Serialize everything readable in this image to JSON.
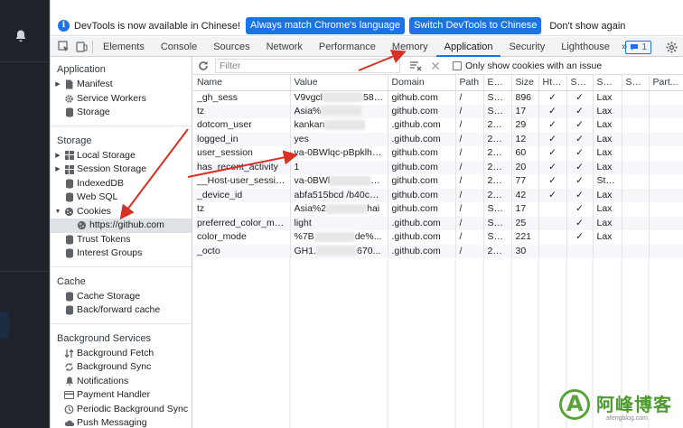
{
  "infobar": {
    "message": "DevTools is now available in Chinese!",
    "match_button": "Always match Chrome's language",
    "switch_button": "Switch DevTools to Chinese",
    "dismiss_button": "Don't show again"
  },
  "tabs": {
    "elements": "Elements",
    "console": "Console",
    "sources": "Sources",
    "network": "Network",
    "performance": "Performance",
    "memory": "Memory",
    "application": "Application",
    "security": "Security",
    "lighthouse": "Lighthouse",
    "more": "»",
    "issues_count": "1"
  },
  "sidebar": {
    "application_title": "Application",
    "manifest": "Manifest",
    "service_workers": "Service Workers",
    "storage": "Storage",
    "storage_title": "Storage",
    "local_storage": "Local Storage",
    "session_storage": "Session Storage",
    "indexeddb": "IndexedDB",
    "web_sql": "Web SQL",
    "cookies": "Cookies",
    "cookies_github": "https://github.com",
    "trust_tokens": "Trust Tokens",
    "interest_groups": "Interest Groups",
    "cache_title": "Cache",
    "cache_storage": "Cache Storage",
    "bf_cache": "Back/forward cache",
    "bg_title": "Background Services",
    "bg_fetch": "Background Fetch",
    "bg_sync": "Background Sync",
    "notifications": "Notifications",
    "payment_handler": "Payment Handler",
    "periodic_bg_sync": "Periodic Background Sync",
    "push_messaging": "Push Messaging"
  },
  "filter": {
    "placeholder": "Filter",
    "issue_label": "Only show cookies with an issue"
  },
  "table": {
    "headers": [
      "Name",
      "Value",
      "Domain",
      "Path",
      "Expi...",
      "Size",
      "Htt...",
      "Sec...",
      "Sam...",
      "Sa...",
      "Part..."
    ],
    "rows": [
      [
        "_gh_sess",
        "V9vgcl",
        "58G...",
        "github.com",
        "/",
        "Ses...",
        "896",
        "✓",
        "✓",
        "Lax",
        "",
        ""
      ],
      [
        "tz",
        "Asia%",
        "",
        "github.com",
        "/",
        "Ses...",
        "17",
        "✓",
        "✓",
        "Lax",
        "",
        ""
      ],
      [
        "dotcom_user",
        "kankan",
        "",
        ".github.com",
        "/",
        "202...",
        "29",
        "✓",
        "✓",
        "Lax",
        "",
        ""
      ],
      [
        "logged_in",
        "yes",
        "",
        ".github.com",
        "/",
        "202...",
        "12",
        "✓",
        "✓",
        "Lax",
        "",
        ""
      ],
      [
        "user_session",
        "va-0BWlqc-pBpklh5by...",
        "",
        "github.com",
        "/",
        "202...",
        "60",
        "✓",
        "✓",
        "Lax",
        "",
        ""
      ],
      [
        "has_recent_activity",
        "1",
        "",
        "github.com",
        "/",
        "202...",
        "20",
        "✓",
        "✓",
        "Lax",
        "",
        ""
      ],
      [
        "__Host-user_session_...",
        "va-0BWl",
        "xlh5by...",
        "github.com",
        "/",
        "202...",
        "77",
        "✓",
        "✓",
        "Strict",
        "",
        ""
      ],
      [
        "_device_id",
        "abfa515bcd /b40cc685...",
        "",
        "github.com",
        "/",
        "202...",
        "42",
        "✓",
        "✓",
        "Lax",
        "",
        ""
      ],
      [
        "tz",
        "Asia%2",
        "hai",
        "github.com",
        "/",
        "Ses...",
        "17",
        "",
        "✓",
        "Lax",
        "",
        ""
      ],
      [
        "preferred_color_mode",
        "light",
        "",
        ".github.com",
        "/",
        "Ses...",
        "25",
        "",
        "✓",
        "Lax",
        "",
        ""
      ],
      [
        "color_mode",
        "%7B",
        "de%...",
        ".github.com",
        "/",
        "Ses...",
        "221",
        "",
        "✓",
        "Lax",
        "",
        ""
      ],
      [
        "_octo",
        "GH1.",
        "670...",
        ".github.com",
        "/",
        "202...",
        "30",
        "",
        "",
        "",
        "",
        ""
      ]
    ]
  },
  "watermark": {
    "brand": "阿峰博客",
    "url": "afengblog.com"
  }
}
